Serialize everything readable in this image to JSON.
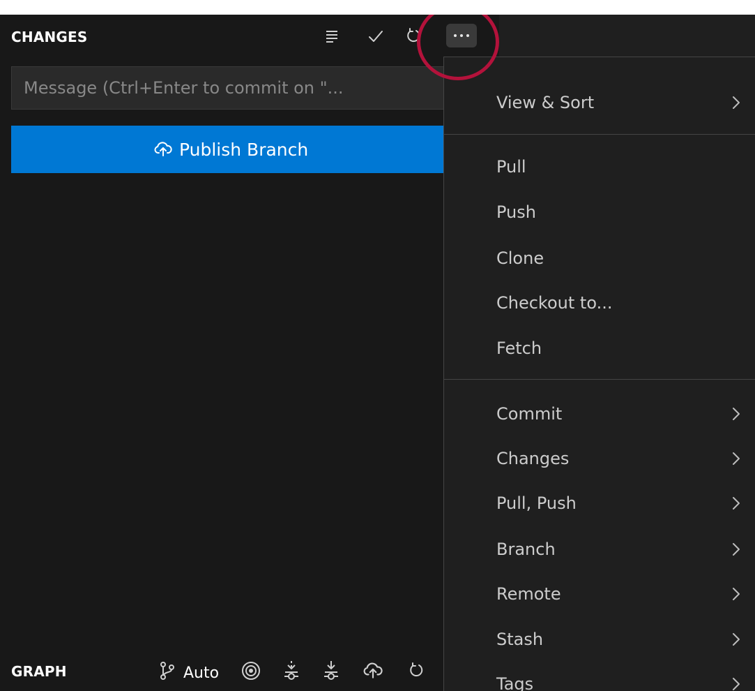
{
  "source_view": {
    "section_title": "CHANGES",
    "toolbar_icons": {
      "view": "list-lines-icon",
      "commit": "check-icon",
      "refresh": "refresh-icon",
      "more": "more-horizontal-icon"
    },
    "message_input": {
      "placeholder": "Message (Ctrl+Enter to commit on \"...",
      "value": ""
    },
    "publish_button": {
      "icon": "cloud-upload-icon",
      "label": "Publish Branch"
    }
  },
  "graph_section": {
    "title": "GRAPH",
    "branch_mode_label": "Auto",
    "icons": [
      "git-branch-icon",
      "target-icon",
      "pull-icon",
      "fetch-icon",
      "cloud-upload-icon",
      "refresh-icon"
    ]
  },
  "context_menu": {
    "items": [
      {
        "label": "View & Sort",
        "submenu": true
      },
      {
        "label": "Pull",
        "submenu": false
      },
      {
        "label": "Push",
        "submenu": false
      },
      {
        "label": "Clone",
        "submenu": false
      },
      {
        "label": "Checkout to...",
        "submenu": false
      },
      {
        "label": "Fetch",
        "submenu": false
      },
      {
        "label": "Commit",
        "submenu": true
      },
      {
        "label": "Changes",
        "submenu": true
      },
      {
        "label": "Pull, Push",
        "submenu": true
      },
      {
        "label": "Branch",
        "submenu": true
      },
      {
        "label": "Remote",
        "submenu": true
      },
      {
        "label": "Stash",
        "submenu": true
      },
      {
        "label": "Tags",
        "submenu": true
      }
    ]
  },
  "colors": {
    "background": "#181818",
    "menu_background": "#1f1f1f",
    "accent": "#0078d4",
    "highlight": "#b3123b",
    "text": "#cccccc"
  }
}
